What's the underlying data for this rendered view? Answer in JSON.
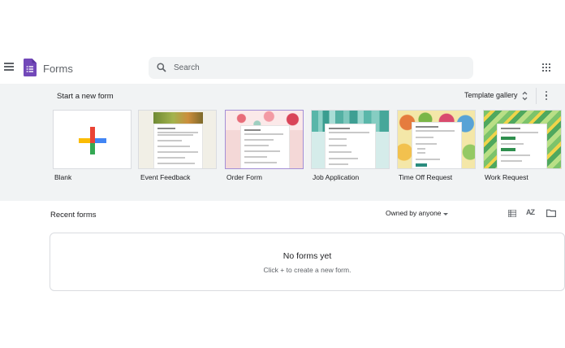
{
  "header": {
    "app_name": "Forms",
    "search_placeholder": "Search"
  },
  "templates": {
    "section_title": "Start a new form",
    "gallery_label": "Template gallery",
    "items": [
      {
        "label": "Blank"
      },
      {
        "label": "Event Feedback"
      },
      {
        "label": "Order Form"
      },
      {
        "label": "Job Application"
      },
      {
        "label": "Time Off Request"
      },
      {
        "label": "Work Request"
      }
    ]
  },
  "recent": {
    "section_title": "Recent forms",
    "owner_filter": "Owned by anyone",
    "sort_label": "AZ",
    "empty_title": "No forms yet",
    "empty_subtitle": "Click + to create a new form."
  },
  "colors": {
    "forms_purple": "#7248b9",
    "band_bg": "#f1f3f4",
    "plus_red": "#ea4335",
    "plus_blue": "#4285f4",
    "plus_yellow": "#fbbc04",
    "plus_green": "#34a853"
  }
}
